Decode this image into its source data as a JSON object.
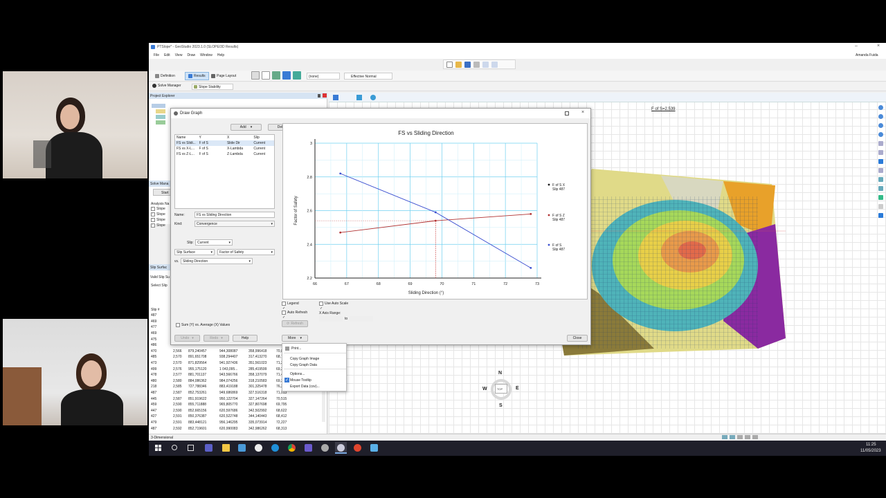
{
  "app": {
    "title": "PTSlope* - GeoStudio 2023.1.0 (SLOPE/3D Results)",
    "user": "Amanda Fuida",
    "menu": [
      "File",
      "Edit",
      "View",
      "Draw",
      "Window",
      "Help"
    ],
    "toolbar_combo_none": "(none)",
    "toolbar_combo_stress": "Effective Normal"
  },
  "tabs": {
    "definition": "Definition",
    "results": "Results",
    "page_layout": "Page Layout",
    "solve_manager": "Solve Manager",
    "slope_stability": "Slope Stability"
  },
  "left_panels": {
    "project_explorer": "Project Explorer",
    "solve_manager": "Solve Mana",
    "analysis": "Analysis Na",
    "slope_items": [
      "Slope",
      "Slope",
      "Slope",
      "Slope"
    ],
    "start": "Start",
    "slip_surfaces": "Slip Surfac",
    "valid_slip": "Valid Slip Su",
    "select_slip": "Select Slip",
    "slip_hash": "Slip #"
  },
  "slip_table": [
    [
      "487",
      "",
      "",
      "",
      "",
      ""
    ],
    [
      "469",
      "",
      "",
      "",
      "",
      ""
    ],
    [
      "477",
      "",
      "",
      "",
      "",
      ""
    ],
    [
      "469",
      "",
      "",
      "",
      "",
      ""
    ],
    [
      "475",
      "",
      "",
      "",
      "",
      ""
    ],
    [
      "486",
      "",
      "",
      "",
      "",
      ""
    ],
    [
      "470",
      "2,566",
      "879,240457",
      "944,308087",
      "358,996418",
      "70,863"
    ],
    [
      "485",
      "2,570",
      "891,651708",
      "938,294407",
      "317,413270",
      "68,725"
    ],
    [
      "473",
      "2,570",
      "871,829564",
      "941,927436",
      "351,561023",
      "71,273"
    ],
    [
      "499",
      "2,576",
      "955,175120",
      "1 043,095...",
      "285,419599",
      "69,281"
    ],
    [
      "478",
      "2,577",
      "881,701137",
      "943,566766",
      "358,137079",
      "71,453"
    ],
    [
      "480",
      "2,580",
      "884,086362",
      "984,074256",
      "318,210583",
      "69,382"
    ],
    [
      "218",
      "2,585",
      "727,788346",
      "883,419188",
      "301,325478",
      "76,28"
    ],
    [
      "487",
      "2,587",
      "852,753261",
      "949,686869",
      "327,516318",
      "71,013"
    ],
    [
      "445",
      "2,587",
      "851,919622",
      "950,122704",
      "327,147264",
      "70,515"
    ],
    [
      "459",
      "2,590",
      "855,711888",
      "965,805770",
      "327,807698",
      "69,795"
    ],
    [
      "447",
      "2,590",
      "852,665156",
      "620,597686",
      "342,502992",
      "68,622"
    ],
    [
      "427",
      "2,591",
      "850,376387",
      "620,522748",
      "344,140443",
      "68,412"
    ],
    [
      "479",
      "2,591",
      "883,448121",
      "956,146295",
      "335,073914",
      "72,227"
    ],
    [
      "487",
      "2,592",
      "852,719601",
      "620,990083",
      "342,986262",
      "68,313"
    ]
  ],
  "draw_graph": {
    "title": "Draw Graph",
    "add": "Add",
    "delete": "Delete",
    "headers": [
      "Name",
      "Y",
      "X",
      "Slip"
    ],
    "rows": [
      [
        "FS vs Slidi...",
        "F of S",
        "Slide Dir",
        "Current"
      ],
      [
        "FS vs X-L...",
        "F of S",
        "X-Lambda",
        "Current"
      ],
      [
        "FS vs Z-L...",
        "F of S",
        "Z-Lambda",
        "Current"
      ]
    ],
    "name_label": "Name:",
    "name_value": "FS vs Sliding Direction",
    "kind_label": "Kind:",
    "kind_value": "Convergence",
    "slip_label": "Slip:",
    "slip_value": "Current",
    "y_source": "Slip Surface",
    "y_param": "Factor of Safety",
    "vs_label": "vs.",
    "x_param": "Sliding Direction",
    "sum_label": "Sum (Y) vs. Average (X) Values",
    "undo": "Undo",
    "redo": "Redo",
    "help": "Help",
    "more": "More",
    "close": "Close",
    "legend": "Legend",
    "auto_refresh": "Auto Refresh",
    "use_auto_scale": "Use Auto Scale",
    "x_axis_range": "X Axis Range:",
    "to": "to",
    "refresh": "Refresh"
  },
  "more_menu": [
    "Print...",
    "Copy Graph Image",
    "Copy Graph Data",
    "Options...",
    "Mouse Tooltip",
    "Export Data (csv)..."
  ],
  "chart_data": {
    "type": "line",
    "title": "FS vs Sliding Direction",
    "xlabel": "Sliding Direction (°)",
    "ylabel": "Factor of Safety",
    "xlim": [
      66,
      73
    ],
    "ylim": [
      2.2,
      3.0
    ],
    "x_ticks": [
      "66",
      "67",
      "68",
      "69",
      "70",
      "71",
      "72",
      "73"
    ],
    "y_ticks": [
      "2.2",
      "2.4",
      "2.6",
      "2.8",
      "3"
    ],
    "grid": true,
    "legend_position": "right",
    "series": [
      {
        "name": "F of S X",
        "sub": "Slip 487",
        "color": "#1a1a1a",
        "x": [],
        "y": []
      },
      {
        "name": "F of S Z",
        "sub": "Slip 487",
        "color": "#b03030",
        "x": [
          66.8,
          69.8,
          72.8
        ],
        "y": [
          2.47,
          2.54,
          2.58
        ]
      },
      {
        "name": "F of S",
        "sub": "Slip 487",
        "color": "#3b4fd0",
        "x": [
          66.8,
          69.8,
          72.8
        ],
        "y": [
          2.82,
          2.59,
          2.26
        ]
      }
    ],
    "marker_x": 69.8
  },
  "viewport": {
    "fos_label": "F of S=2.539",
    "compass": {
      "n": "N",
      "s": "S",
      "e": "E",
      "w": "W",
      "top": "TOP"
    }
  },
  "status_bar": {
    "view": "3-Dimensional"
  },
  "taskbar": {
    "time": "11:25",
    "date": "11/05/2023"
  }
}
